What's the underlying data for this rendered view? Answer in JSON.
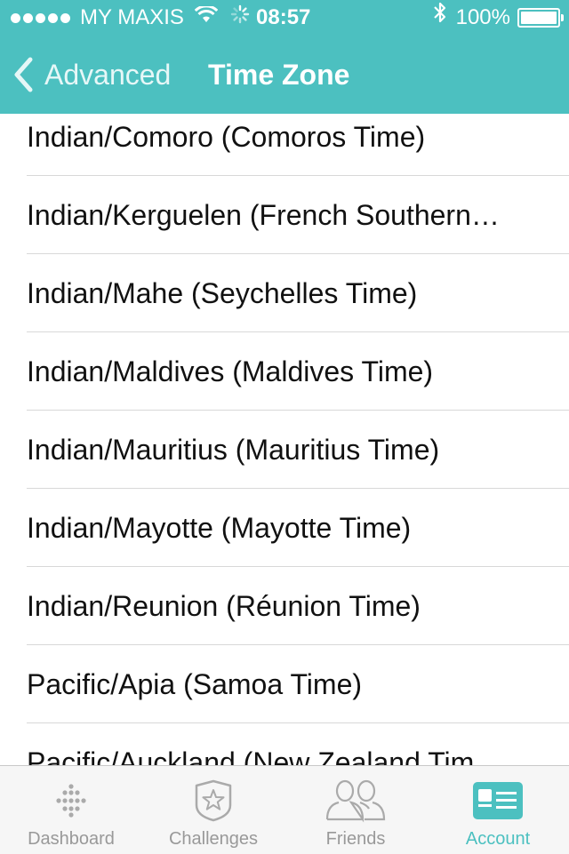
{
  "status_bar": {
    "carrier": "MY MAXIS",
    "time": "08:57",
    "battery": "100%",
    "signal_dots_filled": 5,
    "icons": [
      "wifi-icon",
      "activity-spinner-icon",
      "bluetooth-icon",
      "battery-icon"
    ]
  },
  "nav": {
    "back_label": "Advanced",
    "title": "Time Zone"
  },
  "time_zones": [
    "Indian/Comoro (Comoros Time)",
    "Indian/Kerguelen (French Southern…",
    "Indian/Mahe (Seychelles Time)",
    "Indian/Maldives (Maldives Time)",
    "Indian/Mauritius (Mauritius Time)",
    "Indian/Mayotte (Mayotte Time)",
    "Indian/Reunion (Réunion Time)",
    "Pacific/Apia (Samoa Time)",
    "Pacific/Auckland (New Zealand Tim"
  ],
  "tabs": [
    {
      "label": "Dashboard",
      "icon": "dashboard-dots-icon",
      "active": false
    },
    {
      "label": "Challenges",
      "icon": "challenges-star-badge-icon",
      "active": false
    },
    {
      "label": "Friends",
      "icon": "friends-people-icon",
      "active": false
    },
    {
      "label": "Account",
      "icon": "account-card-icon",
      "active": true
    }
  ],
  "colors": {
    "accent": "#4cc0c0",
    "header_text": "#ffffff",
    "inactive_tab": "#999999",
    "divider": "#d8d8d8"
  }
}
